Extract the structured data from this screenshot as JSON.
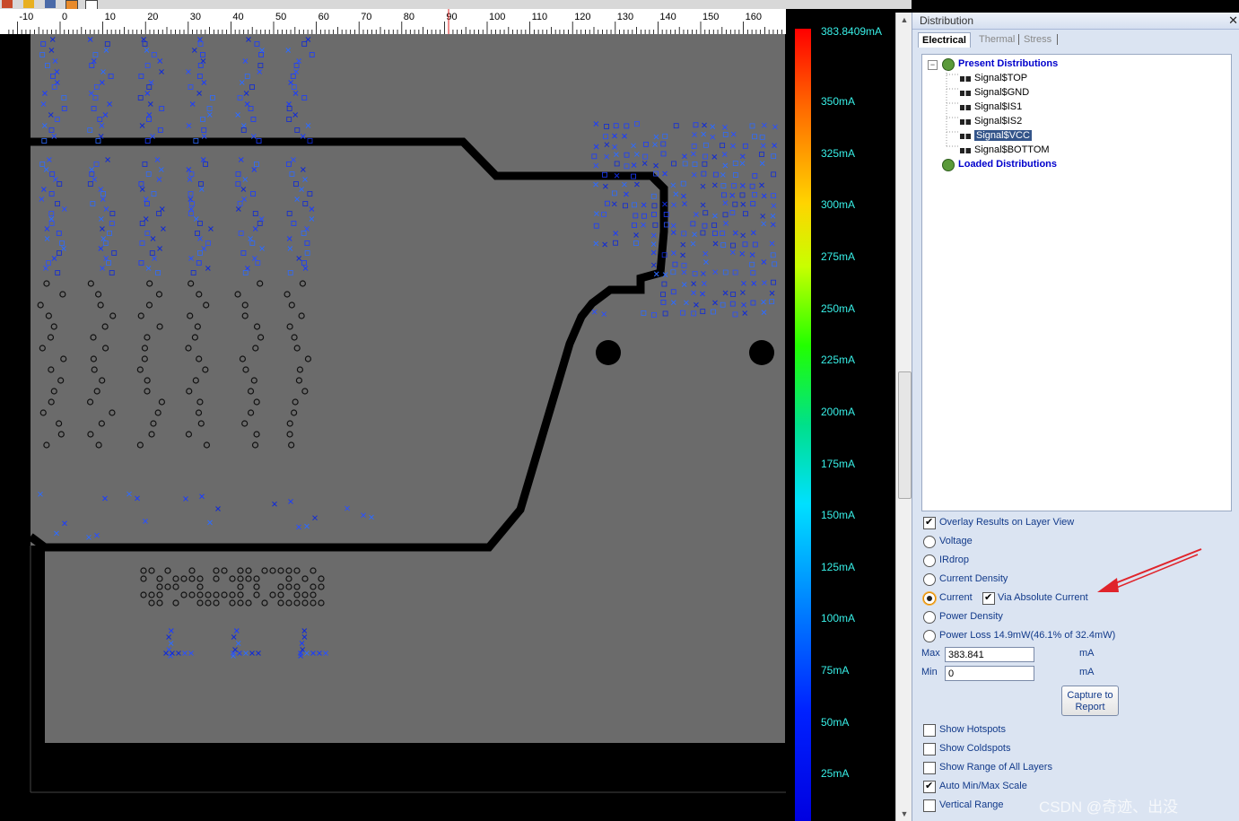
{
  "toolbar": {
    "icons": [
      "pin-icon",
      "folder-icon",
      "layers-icon",
      "view-icon",
      "grid-icon"
    ]
  },
  "ruler": {
    "ticks": [
      "-10",
      "0",
      "10",
      "20",
      "30",
      "40",
      "50",
      "60",
      "70",
      "80",
      "90",
      "100",
      "110",
      "120",
      "130",
      "140",
      "150",
      "160"
    ]
  },
  "colorbar": {
    "labels": [
      "383.8409mA",
      "350mA",
      "325mA",
      "300mA",
      "275mA",
      "250mA",
      "225mA",
      "200mA",
      "175mA",
      "150mA",
      "125mA",
      "100mA",
      "75mA",
      "50mA",
      "25mA"
    ],
    "label_color": "#38f0e8"
  },
  "panel": {
    "title": "Distribution",
    "tabs": [
      "Electrical",
      "Thermal",
      "Stress"
    ],
    "tree": {
      "present_label": "Present Distributions",
      "items": [
        "Signal$TOP",
        "Signal$GND",
        "Signal$IS1",
        "Signal$IS2",
        "Signal$VCC",
        "Signal$BOTTOM"
      ],
      "selected": "Signal$VCC",
      "loaded_label": "Loaded Distributions"
    },
    "overlay_label": "Overlay Results on Layer View",
    "overlay_checked": true,
    "options": [
      "Voltage",
      "IRdrop",
      "Current Density",
      "Current",
      "Power Density",
      "Power Loss 14.9mW(46.1% of 32.4mW)"
    ],
    "selected_option": "Current",
    "via_absolute_label": "Via Absolute Current",
    "via_absolute_checked": true,
    "max_label": "Max",
    "max_value": "383.841",
    "min_label": "Min",
    "min_value": "0",
    "unit": "mA",
    "capture_label_1": "Capture to",
    "capture_label_2": "Report",
    "checks": [
      {
        "label": "Show Hotspots",
        "checked": false
      },
      {
        "label": "Show Coldspots",
        "checked": false
      },
      {
        "label": "Show Range of All Layers",
        "checked": false
      },
      {
        "label": "Auto Min/Max Scale",
        "checked": true
      },
      {
        "label": "Vertical Range",
        "checked": false
      }
    ]
  },
  "watermark": "CSDN @奇迹、出没"
}
